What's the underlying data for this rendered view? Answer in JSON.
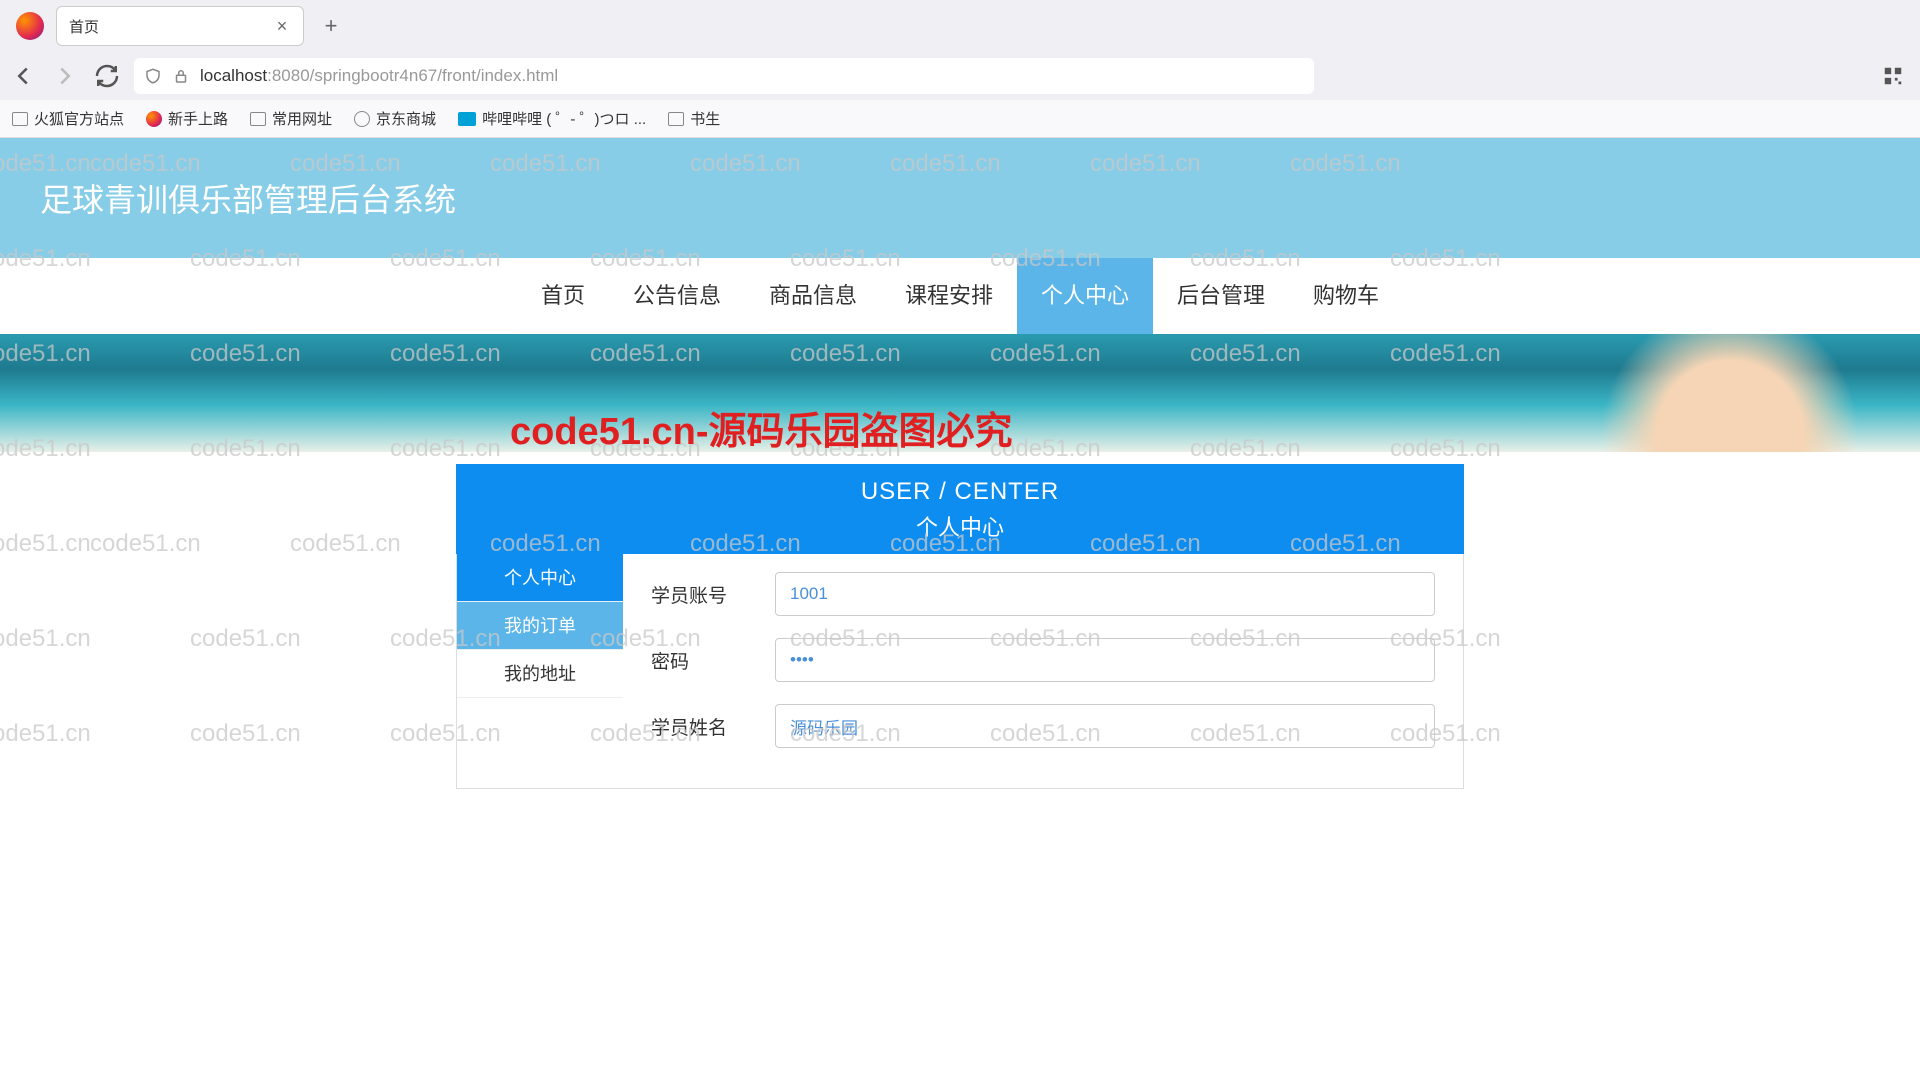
{
  "browser": {
    "tab_title": "首页",
    "url_host": "localhost",
    "url_path": ":8080/springbootr4n67/front/index.html"
  },
  "bookmarks": [
    {
      "label": "火狐官方站点",
      "icon": "folder"
    },
    {
      "label": "新手上路",
      "icon": "firefox"
    },
    {
      "label": "常用网址",
      "icon": "folder"
    },
    {
      "label": "京东商城",
      "icon": "globe"
    },
    {
      "label": "哔哩哔哩 ( ゜- ゜)つロ ...",
      "icon": "bili"
    },
    {
      "label": "书生",
      "icon": "folder"
    }
  ],
  "site": {
    "title": "足球青训俱乐部管理后台系统"
  },
  "nav": {
    "items": [
      {
        "label": "首页",
        "active": false
      },
      {
        "label": "公告信息",
        "active": false
      },
      {
        "label": "商品信息",
        "active": false
      },
      {
        "label": "课程安排",
        "active": false
      },
      {
        "label": "个人中心",
        "active": true
      },
      {
        "label": "后台管理",
        "active": false
      },
      {
        "label": "购物车",
        "active": false
      }
    ]
  },
  "user_center": {
    "title_en": "USER / CENTER",
    "title_cn": "个人中心",
    "sidebar": [
      {
        "label": "个人中心",
        "state": "active"
      },
      {
        "label": "我的订单",
        "state": "hover"
      },
      {
        "label": "我的地址",
        "state": "plain"
      }
    ],
    "form": {
      "account_label": "学员账号",
      "account_value": "1001",
      "password_label": "密码",
      "password_value": "••••",
      "name_label": "学员姓名",
      "name_value": "源码乐园"
    }
  },
  "watermark": {
    "text": "code51.cn",
    "banner_text": "code51.cn-源码乐园盗图必究"
  }
}
